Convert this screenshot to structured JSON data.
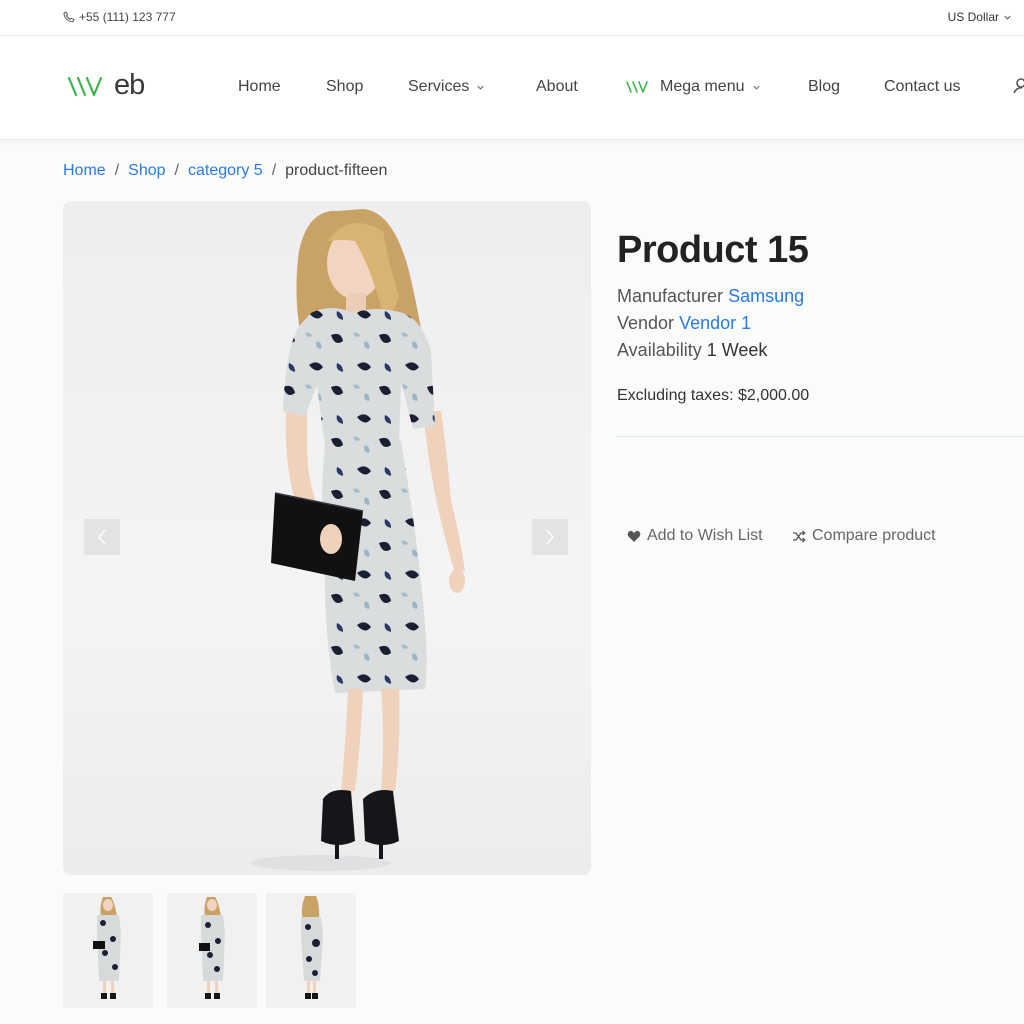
{
  "topbar": {
    "phone": "+55 (111) 123 777",
    "currency": "US Dollar"
  },
  "header": {
    "logo": "eb",
    "nav": [
      {
        "label": "Home"
      },
      {
        "label": "Shop"
      },
      {
        "label": "Services"
      },
      {
        "label": "About"
      },
      {
        "label": "Mega menu"
      },
      {
        "label": "Blog"
      },
      {
        "label": "Contact us"
      }
    ]
  },
  "breadcrumb": {
    "items": [
      "Home",
      "Shop",
      "category 5"
    ],
    "current": "product-fifteen",
    "separator": "/"
  },
  "product": {
    "title": "Product 15",
    "manufacturer_label": "Manufacturer",
    "manufacturer": "Samsung",
    "vendor_label": "Vendor",
    "vendor": "Vendor 1",
    "availability_label": "Availability",
    "availability": "1 Week",
    "price_label": "Excluding taxes:",
    "price": "$2,000.00"
  },
  "actions": {
    "wishlist": "Add to Wish List",
    "compare": "Compare product"
  },
  "colors": {
    "accent": "#2a7ae2",
    "logo_green": "#3bb54a"
  }
}
